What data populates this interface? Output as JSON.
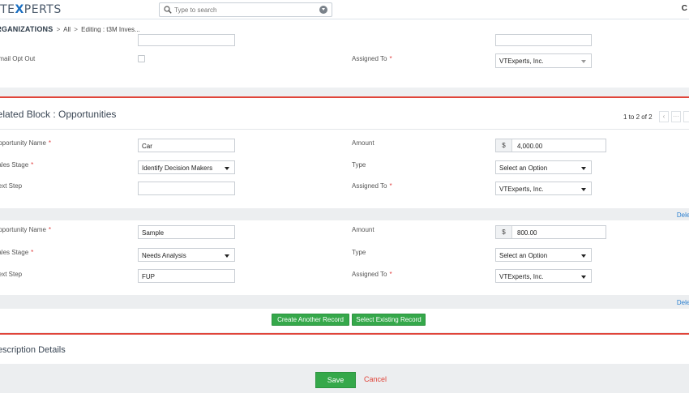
{
  "header": {
    "logo_prefix": "VTE",
    "logo_accent": "X",
    "logo_suffix": "PERTS",
    "search_placeholder": "Type to search",
    "right_glyph": "C"
  },
  "breadcrumb": {
    "module": "ORGANIZATIONS",
    "sep1": ">",
    "all": "All",
    "sep2": ">",
    "editing": "Editing : t3M Inves..."
  },
  "top_section": {
    "email_opt_out_label": "Email Opt Out",
    "assigned_to_label": "Assigned To",
    "assigned_to_value": "VTExperts, Inc.",
    "required_mark": "*"
  },
  "related_block": {
    "title": "Related Block : Opportunities",
    "pager_text": "1 to 2 of 2",
    "pager_prev": "‹",
    "pager_more": "···",
    "records": [
      {
        "opportunity_name_label": "Opportunity Name",
        "opportunity_name": "Car",
        "amount_label": "Amount",
        "currency": "$",
        "amount": "4,000.00",
        "sales_stage_label": "Sales Stage",
        "sales_stage": "Identify Decision Makers",
        "type_label": "Type",
        "type": "Select an Option",
        "next_step_label": "Next Step",
        "next_step": "",
        "assigned_to_label": "Assigned To",
        "assigned_to": "VTExperts, Inc.",
        "delete_label": "Delete"
      },
      {
        "opportunity_name_label": "Opportunity Name",
        "opportunity_name": "Sample",
        "amount_label": "Amount",
        "currency": "$",
        "amount": "800.00",
        "sales_stage_label": "Sales Stage",
        "sales_stage": "Needs Analysis",
        "type_label": "Type",
        "type": "Select an Option",
        "next_step_label": "Next Step",
        "next_step": "FUP",
        "assigned_to_label": "Assigned To",
        "assigned_to": "VTExperts, Inc.",
        "delete_label": "Delete"
      }
    ],
    "create_button": "Create Another Record",
    "select_button": "Select Existing Record"
  },
  "description": {
    "title": "Description Details"
  },
  "footer": {
    "save": "Save",
    "cancel": "Cancel"
  },
  "colors": {
    "accent_red": "#e0453a",
    "button_green": "#35a84a",
    "link_blue": "#2a7fd0",
    "logo_blue": "#1a6fc2"
  }
}
